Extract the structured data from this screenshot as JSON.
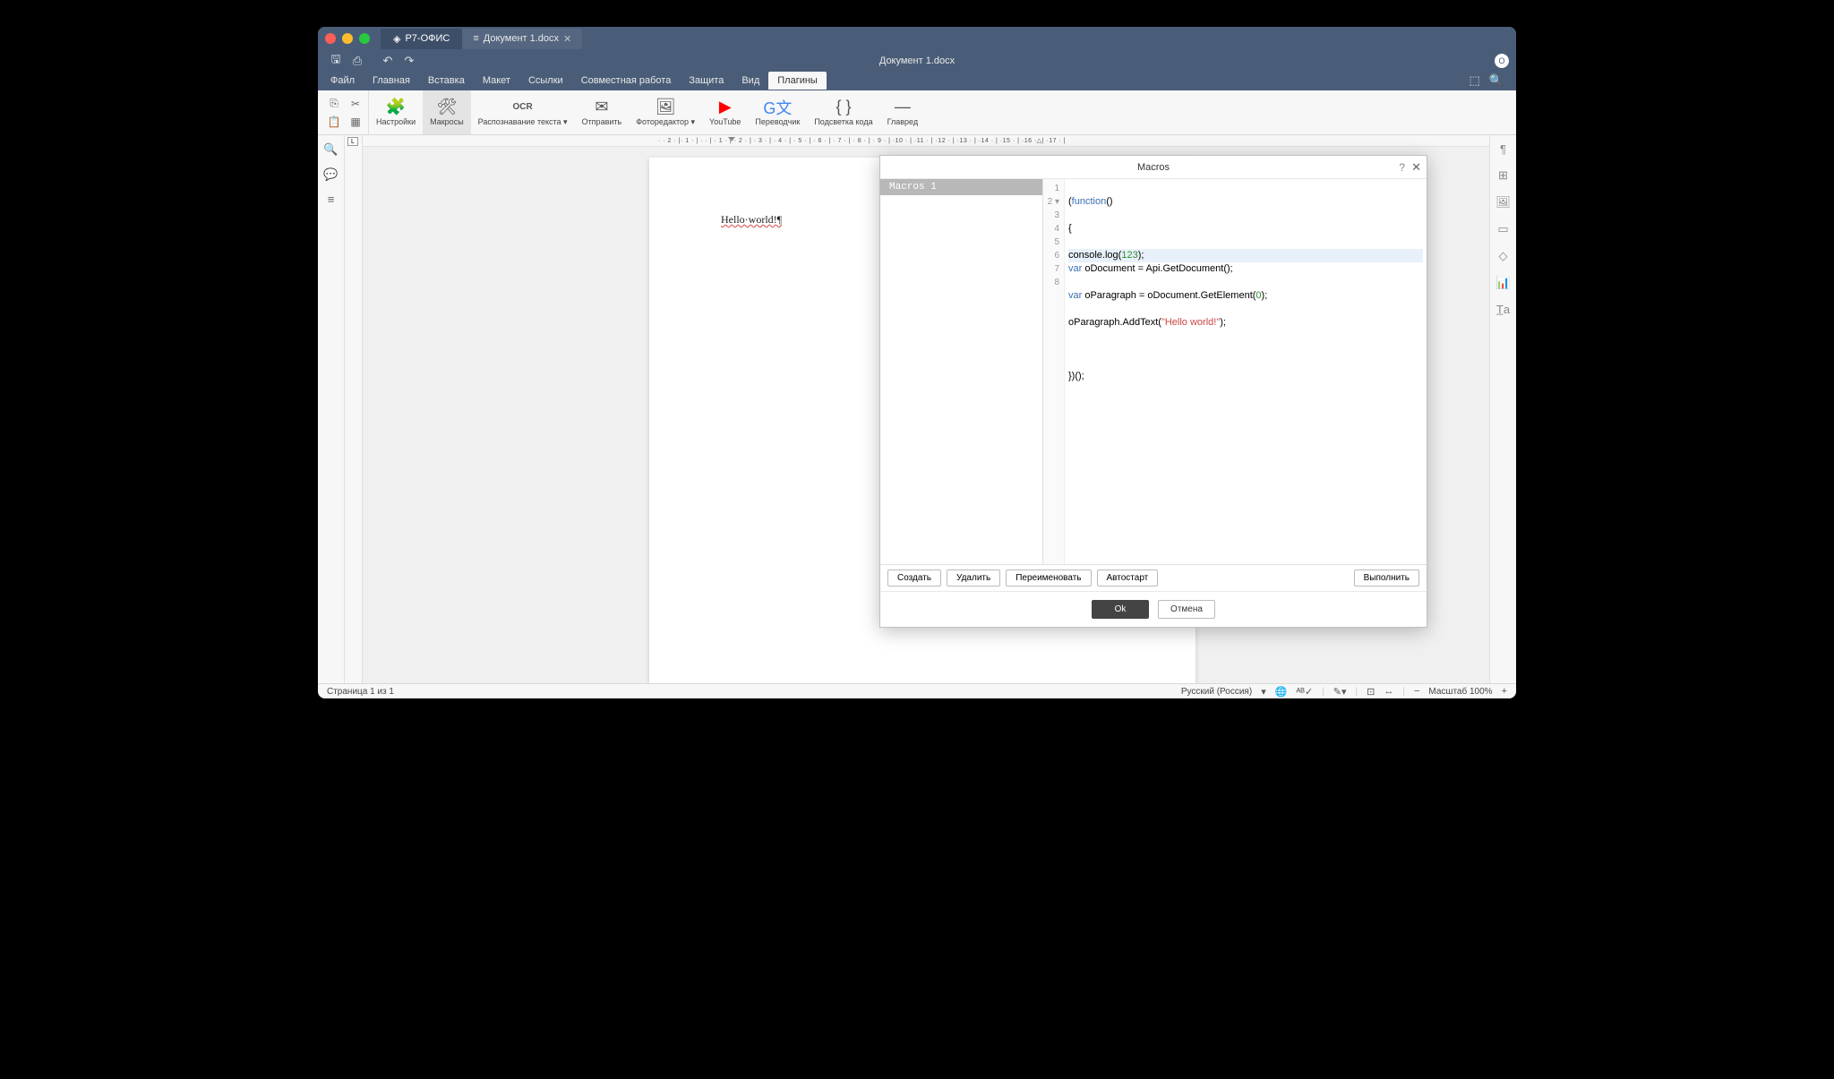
{
  "titlebar": {
    "app_tab": "Р7-ОФИС",
    "doc_tab": "Документ 1.docx"
  },
  "quickbar": {
    "doc_title": "Документ 1.docx"
  },
  "menu": {
    "items": [
      "Файл",
      "Главная",
      "Вставка",
      "Макет",
      "Ссылки",
      "Совместная работа",
      "Защита",
      "Вид",
      "Плагины"
    ],
    "active_index": 8
  },
  "ribbon": {
    "items": [
      {
        "label": "Настройки",
        "icon": "⚙"
      },
      {
        "label": "Макросы",
        "icon": "✕",
        "active": true
      },
      {
        "label": "Распознавание\nтекста ▾",
        "icon": "OCR"
      },
      {
        "label": "Отправить",
        "icon": "✉"
      },
      {
        "label": "Фоторедактор\n▾",
        "icon": "▧"
      },
      {
        "label": "YouTube",
        "icon": "▶"
      },
      {
        "label": "Переводчик",
        "icon": "G文"
      },
      {
        "label": "Подсветка\nкода",
        "icon": "{ }"
      },
      {
        "label": "Главред",
        "icon": "—"
      }
    ]
  },
  "page": {
    "text": "Hello·world!¶"
  },
  "ruler": {
    "ticks": "·  ·  2  · |· 1 · | · · | · 1 · | · 2 · | · 3 · | · 4 · | · 5 · | · 6 · | · 7 · | · 8 · | · 9 · | ·10 · | ·11 · | ·12 · | ·13 · | ·14 · | ·15 · | ·16 ·△| ·17 · |"
  },
  "dialog": {
    "title": "Macros",
    "macro_list": [
      "Macros 1"
    ],
    "code_lines": {
      "l1": {
        "pre": "(",
        "kw": "function",
        "post": "()"
      },
      "l2": "{",
      "l3": {
        "a": "console.log(",
        "num": "123",
        "b": ");"
      },
      "l4": {
        "kw": "var",
        "a": " oDocument = Api.GetDocument();"
      },
      "l5": {
        "kw": "var",
        "a": " oParagraph = oDocument.GetElement(",
        "num": "0",
        "b": ");"
      },
      "l6": {
        "a": "oParagraph.AddText(",
        "str": "\"Hello world!\"",
        "b": ");"
      },
      "l7": "",
      "l8": "})();"
    },
    "gutter": [
      "1",
      "2 ▾",
      "3",
      "4",
      "5",
      "6",
      "7",
      "8"
    ],
    "buttons1": {
      "create": "Создать",
      "delete": "Удалить",
      "rename": "Переименовать",
      "autostart": "Автостарт",
      "run": "Выполнить"
    },
    "buttons2": {
      "ok": "Ok",
      "cancel": "Отмена"
    }
  },
  "statusbar": {
    "page": "Страница 1 из 1",
    "lang": "Русский (Россия)",
    "zoom": "Масштаб 100%"
  }
}
